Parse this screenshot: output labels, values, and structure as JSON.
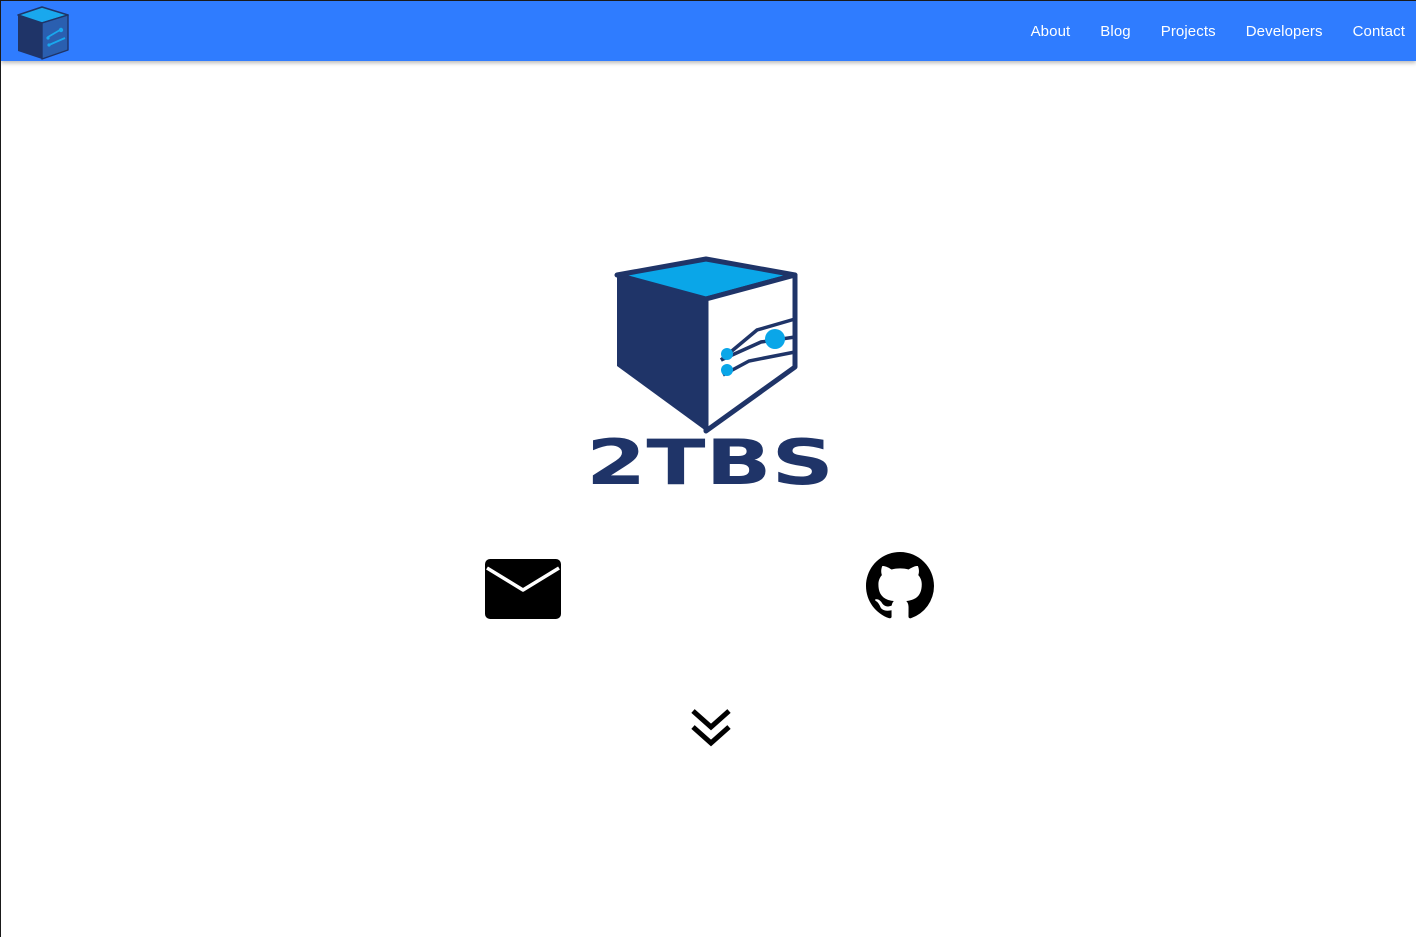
{
  "navbar": {
    "background_color": "#2f7cff",
    "logo_icon": "cube-logo-icon",
    "links": [
      {
        "label": "About"
      },
      {
        "label": "Blog"
      },
      {
        "label": "Projects"
      },
      {
        "label": "Developers"
      },
      {
        "label": "Contact"
      }
    ]
  },
  "hero": {
    "logo_icon": "cube-logo-icon",
    "brand_text": "2TBS",
    "brand_color": "#1f3468",
    "accent_color": "#0aa6e8"
  },
  "contact_icons": [
    {
      "icon": "envelope-icon"
    },
    {
      "icon": "github-icon"
    }
  ],
  "scroll_indicator": {
    "icon": "double-chevron-down-icon"
  }
}
